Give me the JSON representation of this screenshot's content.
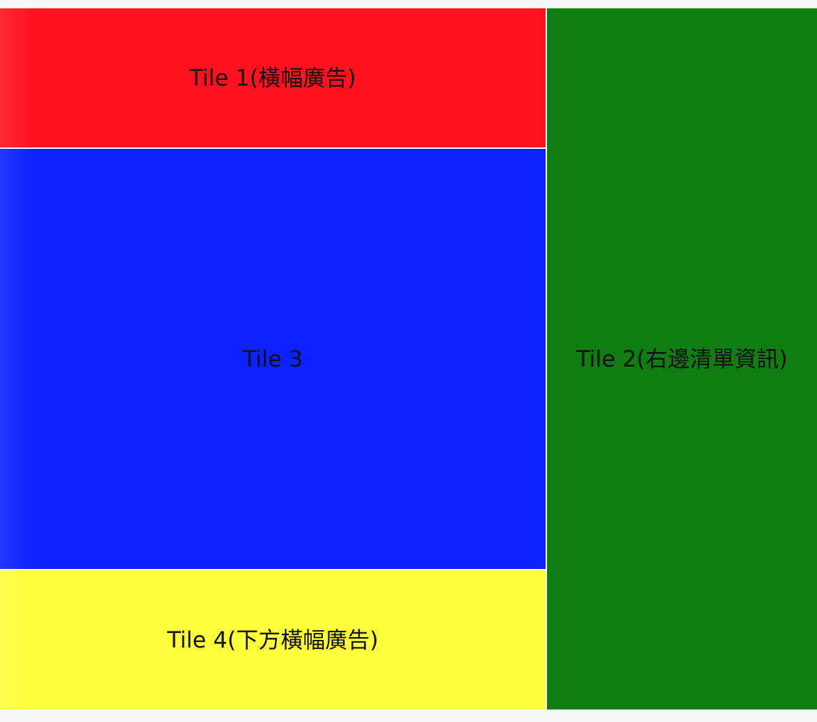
{
  "tiles": [
    {
      "id": "tile-1",
      "label": "Tile 1(橫幅廣告)",
      "color": "#ff111f"
    },
    {
      "id": "tile-2",
      "label": "Tile 2(右邊清單資訊)",
      "color": "#0f7d12"
    },
    {
      "id": "tile-3",
      "label": "Tile 3",
      "color": "#0b22ff"
    },
    {
      "id": "tile-4",
      "label": "Tile 4(下方橫幅廣告)",
      "color": "#ffff3b"
    }
  ]
}
